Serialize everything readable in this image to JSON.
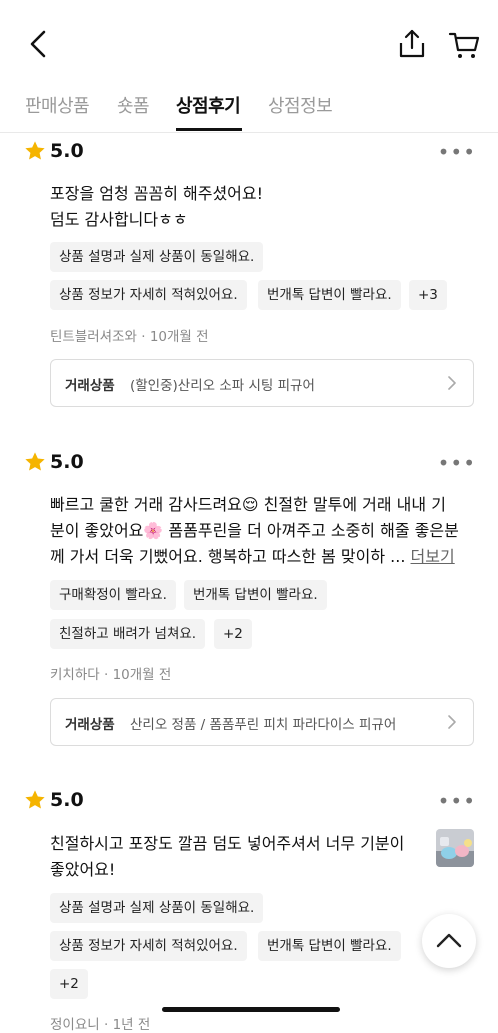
{
  "tabs": [
    {
      "label": "판매상품"
    },
    {
      "label": "숏폼"
    },
    {
      "label": "상점후기"
    },
    {
      "label": "상점정보"
    }
  ],
  "reviews": [
    {
      "score": "5.0",
      "more": "•••",
      "lines": [
        "포장을 엄청 꼼꼼히 해주셨어요!",
        "덤도 감사합니다ㅎㅎ"
      ],
      "chips": [
        "상품 설명과 실제 상품이 동일해요.",
        "상품 정보가 자세히 적혀있어요.",
        "번개톡 답변이 빨라요.",
        "+3"
      ],
      "author": "틴트블러셔조와",
      "time": "· 10개월 전",
      "product_label": "거래상품",
      "product_name": "(할인중)산리오 소파 시팅 피규어"
    },
    {
      "score": "5.0",
      "more": "•••",
      "lines": [
        "빠르고 쿨한 거래 감사드려요😌 친절한 말투에 거래 내내 기",
        "분이 좋았어요🌸 폼폼푸린을 더 아껴주고 소중히 해줄 좋은분",
        "께 가서 더욱 기뻤어요. 행복하고 따스한 봄 맞이하 ..."
      ],
      "more_link": "더보기",
      "chips": [
        "구매확정이 빨라요.",
        "번개톡 답변이 빨라요.",
        "친절하고 배려가 넘쳐요.",
        "+2"
      ],
      "author": "키치하다",
      "time": "· 10개월 전",
      "product_label": "거래상품",
      "product_name": "산리오 정품 / 폼폼푸린 피치 파라다이스 피규어"
    },
    {
      "score": "5.0",
      "more": "•••",
      "lines": [
        "친절하시고 포장도 깔끔 덤도 넣어주셔서 너무 기분이",
        "좋았어요!"
      ],
      "chips": [
        "상품 설명과 실제 상품이 동일해요.",
        "상품 정보가 자세히 적혀있어요.",
        "번개톡 답변이 빨라요.",
        "+2"
      ],
      "author": "정이요니",
      "time": "· 1년 전"
    }
  ]
}
